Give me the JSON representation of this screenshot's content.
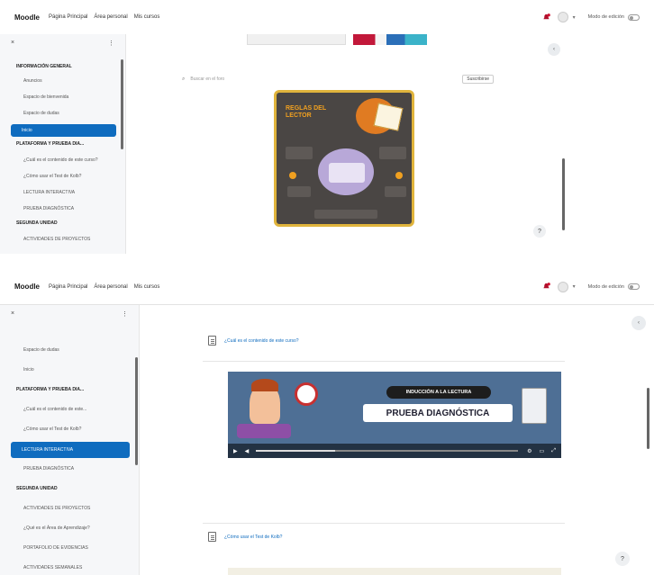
{
  "nav": {
    "brand": "Moodle",
    "links": [
      "Página Principal",
      "Área personal",
      "Mis cursos"
    ],
    "mode_label": "Modo de edición"
  },
  "top": {
    "drawer_items": [
      "INFORMACIÓN GENERAL",
      "Anuncios",
      "Espacio de bienvenida",
      "Espacio de dudas",
      "Inicio",
      "PLATAFORMA Y PRUEBA DIA...",
      "¿Cuál es el contenido de este curso?",
      "¿Cómo usar el Test de Kolb?",
      "LECTURA INTERACTIVA",
      "PRUEBA DIAGNÓSTICA",
      "SEGUNDA UNIDAD",
      "ACTIVIDADES DE PROYECTOS"
    ],
    "search_placeholder": "Buscar en el foro",
    "dropdown_label": "Suscribirse",
    "infographic": {
      "title": "REGLAS DEL LECTOR"
    }
  },
  "bottom": {
    "drawer_items": [
      "Espacio de dudas",
      "Inicio",
      "PLATAFORMA Y PRUEBA DIA...",
      "¿Cuál es el contenido de este...",
      "¿Cómo usar el Test de Kolb?",
      "LECTURA INTERACTIVA",
      "PRUEBA DIAGNÓSTICA",
      "SEGUNDA UNIDAD",
      "ACTIVIDADES DE PROYECTOS",
      "¿Qué es el Área de Aprendizaje?",
      "PORTAFOLIO DE EVIDENCIAS",
      "ACTIVIDADES SEMANALES"
    ],
    "activity1": "¿Cuál es el contenido de este curso?",
    "activity2": "¿Cómo usar el Test de Kolb?",
    "video": {
      "tag": "INDUCCIÓN A LA LECTURA",
      "title": "PRUEBA DIAGNÓSTICA"
    }
  }
}
